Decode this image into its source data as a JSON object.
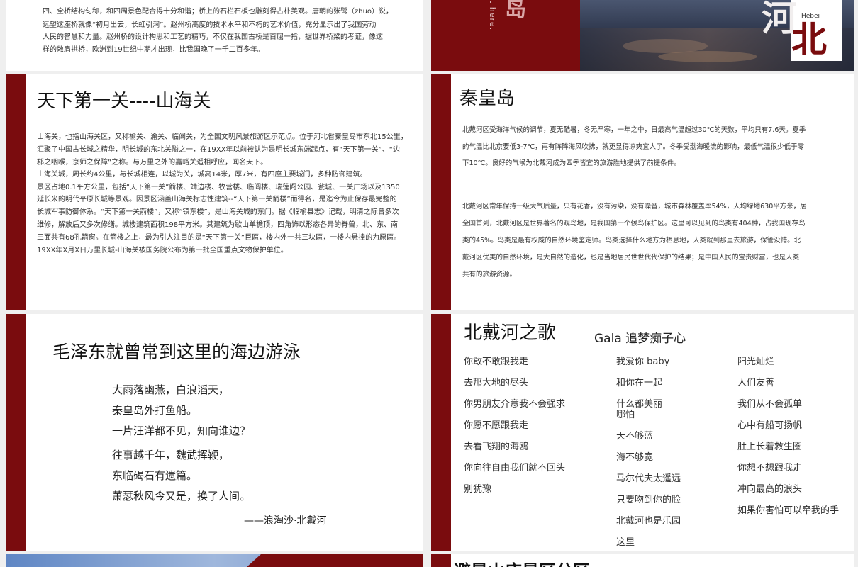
{
  "slide1": {
    "paragraph": [
      "四、全桥结构匀称，和四周景色配合得十分和谐；桥上的石栏石板也雕刻得古朴美观。唐朝的张鹭（zhuo）说，",
      "远望这座桥就像“初月出云，长虹引涧”。赵州桥高度的技术水平和不朽的艺术价值，充分显示出了我国劳动",
      "人民的智慧和力量。赵州桥的设计构思和工艺的精巧，不仅在我国古桥是首屈一指，据世界桥梁的考证，像这",
      "样的敞肩拱桥，欧洲到19世纪中期才出现，比我国晚了一千二百多年。"
    ]
  },
  "slide2": {
    "vertical_text": "t here.",
    "big_char_top": "岛",
    "big_char_he": "河",
    "big_char_bei": "北",
    "small_label": "Hebei"
  },
  "slide3": {
    "title": "天下第一关----山海关",
    "lines": [
      "山海关，也指山海关区，又称榆关、渝关、临闾关，为全国文明风景旅游区示范点。位于河北省秦皇岛市东北15公里，",
      "汇聚了中国古长城之精华，明长城的东北关隘之一，在19XX年以前被认为是明长城东端起点，有“天下第一关”、“边",
      "郡之咽喉，京师之保障”之称。与万里之外的嘉峪关遥相呼应，闻名天下。",
      "山海关城，周长约4公里，与长城相连，以城为关，城高14米，厚7米，有四座主要城门，多种防御建筑。",
      "景区占地0.1平方公里，包括“天下第一关”箭楼、靖边楼、牧营楼、临闾楼、瑞莲阁公园、瓮城、一关广场以及1350",
      "延长米的明代平原长城等景观。因景区涵盖山海关标志性建筑--“天下第一关箭楼”而得名，是迄今为止保存最完整的",
      "长城军事防御体系。“天下第一关箭楼”，又称“镇东楼”，是山海关城的东门。据《临榆县志》记载，明清之际曾多次",
      "维修，解放后又多次修缮。城楼建筑面积198平方米。其建筑为歇山单檐顶，四角饰以形态各异的脊兽，北、东、南",
      "三面共有68孔箭窗。在箭楼之上，最为引人注目的是“天下第一关”巨匾，楼内外一共三块匾，一楼内悬挂的为原匾。",
      "19XX年X月X日万里长城-山海关被国务院公布为第一批全国重点文物保护单位。"
    ]
  },
  "slide4": {
    "title": "秦皇岛",
    "para1": [
      "北戴河区受海洋气候的调节，夏无酷暑，冬无严寒，一年之中，日最高气温超过30℃的天数，平均只有7.6天。夏季",
      "的气温比北京要低3-7℃，再有阵阵海风吹拂，就更显得凉爽宜人了。冬季受渤海暖流的影响，最低气温很少低于零",
      "下10℃。良好的气候为北戴河成为四季皆宜的旅游胜地提供了前提条件。"
    ],
    "para2": [
      "北戴河区常年保持一级大气质量，只有花香，没有污染，没有噪音，城市森林覆盖率54%，人均绿地630平方米，居",
      "全国首列，北戴河区是世界著名的观鸟地，是我国第一个候鸟保护区。这里可以见到的鸟类有404种，占我国现存鸟",
      "类的45%。鸟类是最有权威的自然环境鉴定师。鸟类选择什么地方为栖息地，人类就到那里去旅游，保管没错。北",
      "戴河区优美的自然环境，是大自然的造化，也是当地居民世世代代保护的结果；是中国人民的宝贵财富，也是人类",
      "共有的旅游资源。"
    ]
  },
  "slide5": {
    "title": "毛泽东就曾常到这里的海边游泳",
    "poem": [
      "大雨落幽燕，白浪滔天，",
      "秦皇岛外打鱼船。",
      "一片汪洋都不见，知向谁边？",
      "往事越千年，魏武挥鞭，",
      "东临碣石有遗篇。",
      "萧瑟秋风今又是，换了人间。"
    ],
    "attribution": "——浪淘沙·北戴河"
  },
  "slide6": {
    "title": "北戴河之歌",
    "subtitle": "Gala 追梦痴子心",
    "col1": [
      "你敢不敢跟我走",
      "去那大地的尽头",
      "你男朋友介意我不会强求",
      "你愿不愿跟我走",
      "去看飞翔的海鸥",
      "你向往自由我们就不回头",
      "别犹豫"
    ],
    "col2": [
      "我爱你 baby",
      "和你在一起",
      "什么都美丽",
      "哪怕",
      "天不够蓝",
      "海不够宽",
      "马尔代夫太遥远",
      "只要吻到你的脸",
      "北戴河也是乐园",
      "这里"
    ],
    "col3": [
      "阳光灿烂",
      "人们友善",
      "我们从不会孤单",
      "心中有船可扬帆",
      "肚上长着救生圈",
      "你想不想跟我走",
      "冲向最高的浪头",
      "如果你害怕可以牵我的手"
    ]
  },
  "slide8": {
    "title": "避暑山庄景区分区"
  },
  "colors": {
    "accent": "#7a0c0e",
    "background": "#efefef"
  }
}
